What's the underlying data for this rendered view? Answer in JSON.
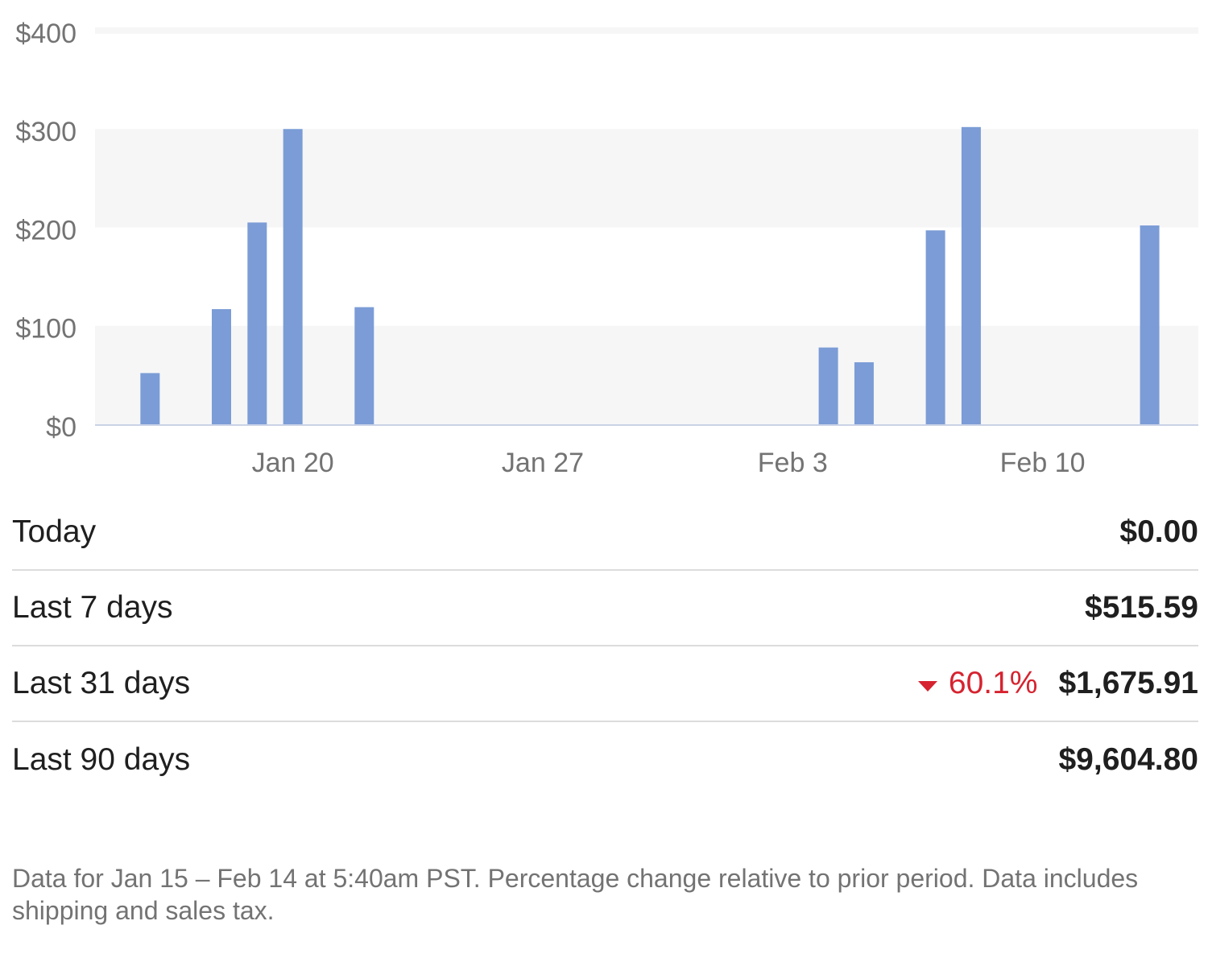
{
  "chart_data": {
    "type": "bar",
    "title": "",
    "xlabel": "",
    "ylabel": "",
    "ylim": [
      0,
      400
    ],
    "y_ticks": [
      0,
      100,
      200,
      300,
      400
    ],
    "y_tick_labels": [
      "$0",
      "$100",
      "$200",
      "$300",
      "$400"
    ],
    "x": [
      "2024-01-15",
      "2024-01-16",
      "2024-01-17",
      "2024-01-18",
      "2024-01-19",
      "2024-01-20",
      "2024-01-21",
      "2024-01-22",
      "2024-01-23",
      "2024-01-24",
      "2024-01-25",
      "2024-01-26",
      "2024-01-27",
      "2024-01-28",
      "2024-01-29",
      "2024-01-30",
      "2024-01-31",
      "2024-02-01",
      "2024-02-02",
      "2024-02-03",
      "2024-02-04",
      "2024-02-05",
      "2024-02-06",
      "2024-02-07",
      "2024-02-08",
      "2024-02-09",
      "2024-02-10",
      "2024-02-11",
      "2024-02-12",
      "2024-02-13",
      "2024-02-14"
    ],
    "x_tick_positions": [
      "2024-01-20",
      "2024-01-27",
      "2024-02-03",
      "2024-02-10"
    ],
    "x_tick_labels": [
      "Jan 20",
      "Jan 27",
      "Feb 3",
      "Feb 10"
    ],
    "series": [
      {
        "values": [
          0,
          52,
          0,
          117,
          205,
          300,
          0,
          119,
          0,
          0,
          0,
          0,
          0,
          0,
          0,
          0,
          0,
          0,
          0,
          0,
          78,
          63,
          0,
          197,
          302,
          0,
          0,
          0,
          0,
          202,
          0
        ]
      }
    ],
    "bar_color": "#7b9cd6",
    "grid": "alternating-bands",
    "legend": "none"
  },
  "summary": [
    {
      "label": "Today",
      "value": "$0.00"
    },
    {
      "label": "Last 7 days",
      "value": "$515.59"
    },
    {
      "label": "Last 31 days",
      "value": "$1,675.91",
      "change": "60.1%",
      "change_direction": "down",
      "change_icon": "triangle-down-icon"
    },
    {
      "label": "Last 90 days",
      "value": "$9,604.80"
    }
  ],
  "colors": {
    "change_down": "#d6232f",
    "bar": "#7b9cd6",
    "band": "#f6f6f7",
    "axis": "#c9d2e6"
  },
  "footnote": "Data for Jan 15 – Feb 14 at 5:40am PST. Percentage change relative to prior period. Data includes shipping and sales tax."
}
